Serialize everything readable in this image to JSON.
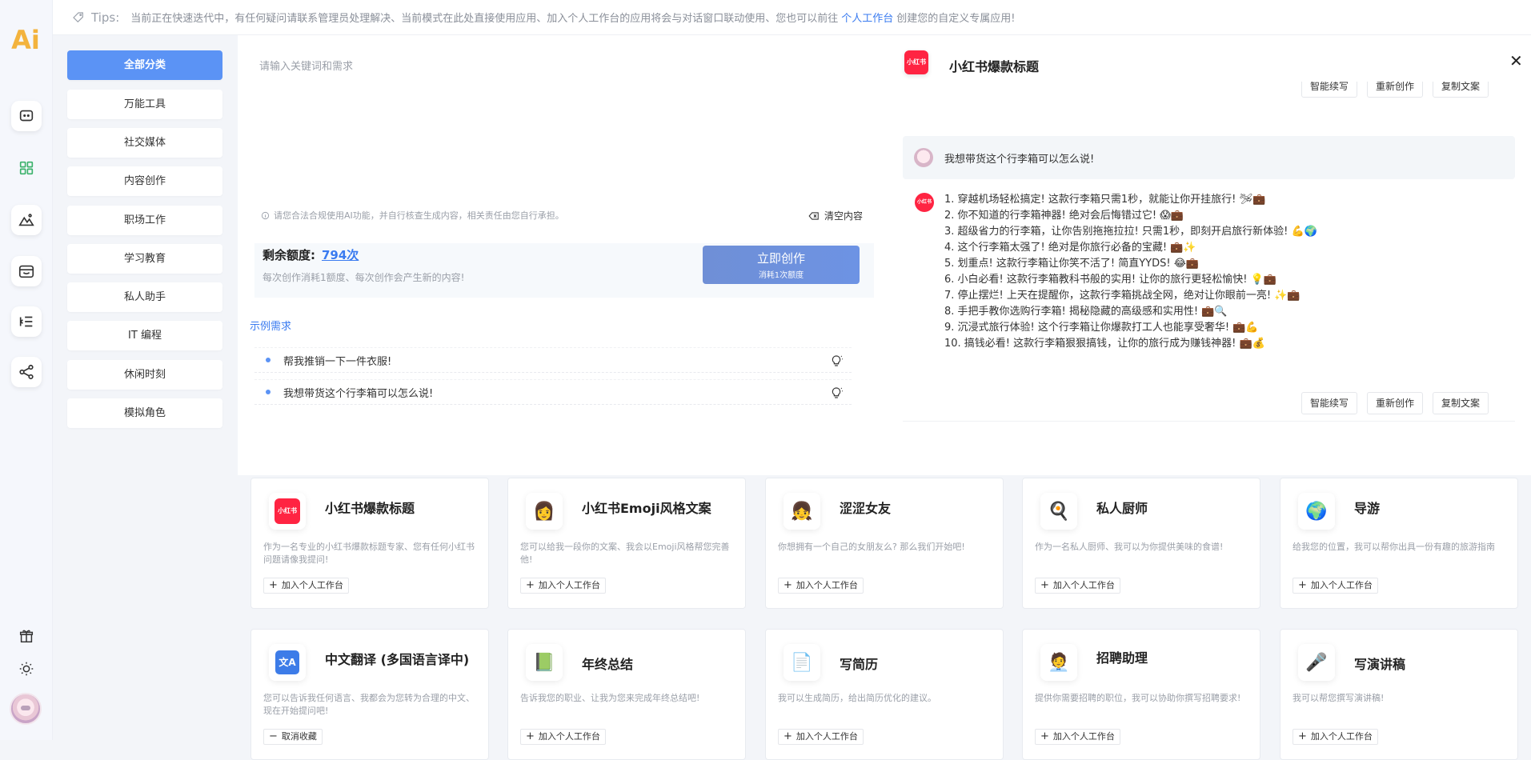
{
  "logo": {
    "text_a": "A",
    "text_b": "i"
  },
  "tips": {
    "label": "Tips:",
    "text": "当前正在快速迭代中，有任何疑问请联系管理员处理解决、当前模式在此处直接使用应用、加入个人工作台的应用将会与对话窗口联动使用、您也可以前往",
    "link": "个人工作台",
    "after": "创建您的自定义专属应用!"
  },
  "categories": [
    "全部分类",
    "万能工具",
    "社交媒体",
    "内容创作",
    "职场工作",
    "学习教育",
    "私人助手",
    "IT 编程",
    "休闲时刻",
    "模拟角色"
  ],
  "editor": {
    "placeholder": "请输入关键词和需求",
    "disclaimer": "请您合法合规使用AI功能，并自行核查生成内容，相关责任由您自行承担。",
    "clear_label": "清空内容",
    "quota_label": "剩余额度:",
    "quota_value": "794次",
    "quota_note": "每次创作消耗1额度、每次创作会产生新的内容!",
    "create_label": "立即创作",
    "create_sub": "消耗1次额度",
    "examples_title": "示例需求",
    "examples": [
      "帮我推销一下一件衣服!",
      "我想带货这个行李箱可以怎么说!"
    ]
  },
  "chat": {
    "app_icon_text": "小红书",
    "title": "小红书爆款标题",
    "close": "✕",
    "user_message": "我想带货这个行李箱可以怎么说!",
    "reply_icon_text": "小红书",
    "reply": [
      "1. 穿越机场轻松搞定! 这款行李箱只需1秒，就能让你开挂旅行! 🛩💼",
      "2. 你不知道的行李箱神器! 绝对会后悔错过它! 😱💼",
      "3. 超级省力的行李箱，让你告别拖拖拉拉! 只需1秒，即刻开启旅行新体验! 💪🌍",
      "4. 这个行李箱太强了! 绝对是你旅行必备的宝藏! 💼✨",
      "5. 划重点! 这款行李箱让你笑不活了! 简直YYDS! 😂💼",
      "6. 小白必看! 这款行李箱教科书般的实用! 让你的旅行更轻松愉快! 💡💼",
      "7. 停止摆烂! 上天在提醒你，这款行李箱挑战全网，绝对让你眼前一亮! ✨💼",
      "8. 手把手教你选购行李箱! 揭秘隐藏的高级感和实用性! 💼🔍",
      "9. 沉浸式旅行体验! 这个行李箱让你爆款打工人也能享受奢华! 💼💪",
      "10. 搞钱必看! 这款行李箱狠狠搞钱，让你的旅行成为赚钱神器! 💼💰"
    ],
    "actions": [
      "智能续写",
      "重新创作",
      "复制文案"
    ]
  },
  "cards": [
    {
      "icon": "小红书",
      "title": "小红书爆款标题",
      "desc": "作为一名专业的小红书爆款标题专家、您有任何小红书问题请像我提问!",
      "add": "加入个人工作台",
      "sign": "+"
    },
    {
      "icon": "👩",
      "title": "小红书Emoji风格文案",
      "desc": "您可以给我一段你的文案、我会以Emoji风格帮您完善他!",
      "add": "加入个人工作台",
      "sign": "+"
    },
    {
      "icon": "👧",
      "title": "涩涩女友",
      "desc": "你想拥有一个自己的女朋友么? 那么我们开始吧!",
      "add": "加入个人工作台",
      "sign": "+"
    },
    {
      "icon": "🍳",
      "title": "私人厨师",
      "desc": "作为一名私人厨师、我可以为你提供美味的食谱!",
      "add": "加入个人工作台",
      "sign": "+"
    },
    {
      "icon": "🌍",
      "title": "导游",
      "desc": "给我您的位置，我可以帮你出具一份有趣的旅游指南",
      "add": "加入个人工作台",
      "sign": "+"
    },
    {
      "icon": "文A",
      "title": "中文翻译 (多国语言译中)",
      "desc": "您可以告诉我任何语言、我都会为您转为合理的中文、现在开始提问吧!",
      "add": "取消收藏",
      "sign": "−"
    },
    {
      "icon": "📗",
      "title": "年终总结",
      "desc": "告诉我您的职业、让我为您来完成年终总结吧!",
      "add": "加入个人工作台",
      "sign": "+"
    },
    {
      "icon": "📄",
      "title": "写简历",
      "desc": "我可以生成简历，给出简历优化的建议。",
      "add": "加入个人工作台",
      "sign": "+"
    },
    {
      "icon": "🧑‍💼",
      "title": "招聘助理",
      "desc": "提供你需要招聘的职位，我可以协助你撰写招聘要求!",
      "add": "加入个人工作台",
      "sign": "+"
    },
    {
      "icon": "🎤",
      "title": "写演讲稿",
      "desc": "我可以帮您撰写演讲稿!",
      "add": "加入个人工作台",
      "sign": "+"
    }
  ]
}
